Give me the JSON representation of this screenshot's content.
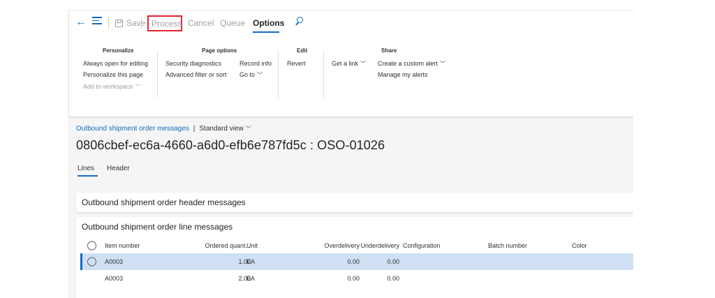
{
  "toolbar": {
    "back_icon": "back-arrow-icon",
    "menu_icon": "hamburger-icon",
    "save_label": "Save",
    "process_label": "Process",
    "cancel_label": "Cancel",
    "queue_label": "Queue",
    "options_label": "Options",
    "search_icon": "search-icon",
    "accent_color": "#0f6cbd",
    "highlight_color": "#e0252d"
  },
  "ribbon": {
    "personalize": {
      "title": "Personalize",
      "items": [
        "Always open for editing",
        "Personalize this page",
        "Add to workspace"
      ]
    },
    "page_options": {
      "title": "Page options",
      "items": [
        "Security diagnostics",
        "Advanced filter or sort",
        "Record info",
        "Go to"
      ]
    },
    "edit": {
      "title": "Edit",
      "items": [
        "Revert"
      ]
    },
    "share": {
      "title": "Share",
      "items": [
        "Get a link",
        "Create a custom alert",
        "Manage my alerts"
      ]
    }
  },
  "page": {
    "breadcrumb_link": "Outbound shipment order messages",
    "breadcrumb_sep": "|",
    "view_label": "Standard view",
    "title": "0806cbef-ec6a-4660-a6d0-efb6e787fd5c : OSO-01026",
    "tabs": [
      "Lines",
      "Header"
    ]
  },
  "sections": {
    "header_messages": "Outbound shipment order header messages",
    "line_messages": "Outbound shipment order line messages"
  },
  "grid": {
    "columns": [
      "Item number",
      "Ordered quant...",
      "Unit",
      "Overdelivery",
      "Underdelivery",
      "Configuration",
      "Batch number",
      "Color"
    ],
    "rows": [
      {
        "item": "A0003",
        "ordered": "1.00",
        "unit": "EA",
        "over": "0.00",
        "under": "0.00",
        "config": "",
        "batch": "",
        "color": ""
      },
      {
        "item": "A0003",
        "ordered": "2.00",
        "unit": "EA",
        "over": "0.00",
        "under": "0.00",
        "config": "",
        "batch": "",
        "color": ""
      }
    ]
  }
}
